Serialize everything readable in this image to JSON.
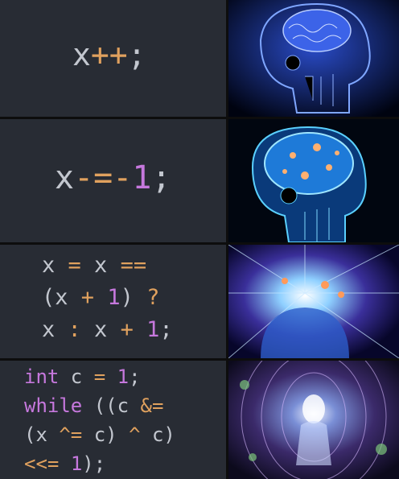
{
  "panels": [
    {
      "tokens": [
        {
          "t": "x",
          "c": "id"
        },
        {
          "t": "++",
          "c": "op"
        },
        {
          "t": ";",
          "c": "punct"
        }
      ]
    },
    {
      "tokens": [
        {
          "t": "x",
          "c": "id"
        },
        {
          "t": "-=-",
          "c": "op"
        },
        {
          "t": "1",
          "c": "num"
        },
        {
          "t": ";",
          "c": "punct"
        }
      ]
    },
    {
      "lines": [
        [
          {
            "t": "x ",
            "c": "id"
          },
          {
            "t": "=",
            "c": "op"
          },
          {
            "t": " x ",
            "c": "id"
          },
          {
            "t": "==",
            "c": "op"
          }
        ],
        [
          {
            "t": "(x ",
            "c": "id"
          },
          {
            "t": "+",
            "c": "op"
          },
          {
            "t": " ",
            "c": "id"
          },
          {
            "t": "1",
            "c": "num"
          },
          {
            "t": ") ",
            "c": "id"
          },
          {
            "t": "?",
            "c": "op"
          }
        ],
        [
          {
            "t": "x ",
            "c": "id"
          },
          {
            "t": ":",
            "c": "op"
          },
          {
            "t": " x ",
            "c": "id"
          },
          {
            "t": "+",
            "c": "op"
          },
          {
            "t": " ",
            "c": "id"
          },
          {
            "t": "1",
            "c": "num"
          },
          {
            "t": ";",
            "c": "punct"
          }
        ]
      ]
    },
    {
      "lines": [
        [
          {
            "t": "int",
            "c": "kw"
          },
          {
            "t": " c ",
            "c": "id"
          },
          {
            "t": "=",
            "c": "op"
          },
          {
            "t": " ",
            "c": "id"
          },
          {
            "t": "1",
            "c": "num"
          },
          {
            "t": ";",
            "c": "punct"
          }
        ],
        [
          {
            "t": "while",
            "c": "kw"
          },
          {
            "t": " ((c ",
            "c": "id"
          },
          {
            "t": "&=",
            "c": "op"
          }
        ],
        [
          {
            "t": "(x ",
            "c": "id"
          },
          {
            "t": "^=",
            "c": "op"
          },
          {
            "t": " c) ",
            "c": "id"
          },
          {
            "t": "^",
            "c": "op"
          },
          {
            "t": " c)",
            "c": "id"
          }
        ],
        [
          {
            "t": "<<=",
            "c": "op"
          },
          {
            "t": " ",
            "c": "id"
          },
          {
            "t": "1",
            "c": "num"
          },
          {
            "t": ");",
            "c": "punct"
          }
        ]
      ]
    }
  ],
  "images": [
    "brain-xray-icon",
    "glowing-brain-icon",
    "cosmic-brain-icon",
    "galaxy-being-icon"
  ]
}
